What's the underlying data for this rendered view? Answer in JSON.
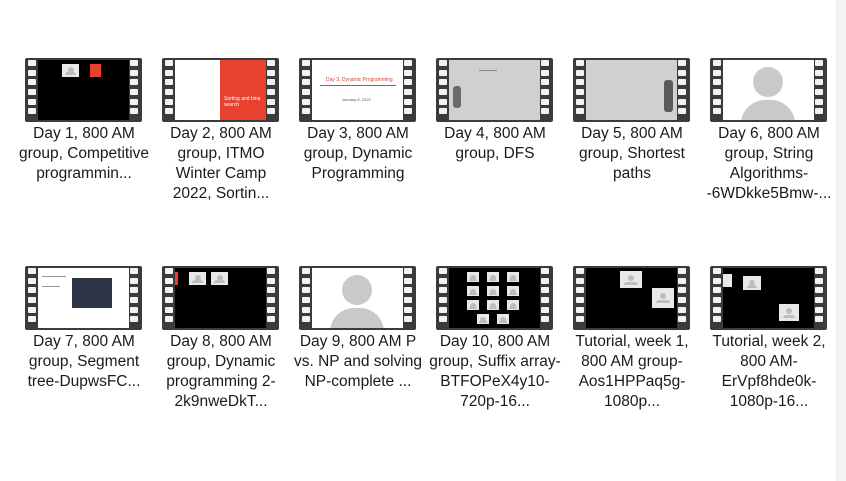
{
  "videos": [
    {
      "label": "Day 1, 800 AM group, Competitive programmin...",
      "thumbnail": "black-screen-with-participant-tiles"
    },
    {
      "label": "Day 2, 800 AM group, ITMO Winter Camp 2022, Sortin...",
      "thumbnail": "slide-sorting",
      "slide_text": "Sorting and bina search"
    },
    {
      "label": "Day 3, 800 AM group, Dynamic Programming",
      "thumbnail": "slide-title",
      "slide_text": "Day 3, Dynamic Programming",
      "slide_date": "January 6, 2022"
    },
    {
      "label": "Day 4, 800 AM group, DFS",
      "thumbnail": "whiteboard"
    },
    {
      "label": "Day 5, 800 AM group, Shortest paths",
      "thumbnail": "whiteboard"
    },
    {
      "label": "Day 6, 800 AM group, String Algorithms--6WDkke5Bmw-...",
      "thumbnail": "avatar"
    },
    {
      "label": "Day 7, 800 AM group, Segment tree-DupwsFC...",
      "thumbnail": "screen-share-code"
    },
    {
      "label": "Day 8, 800 AM group, Dynamic programming 2-2k9nweDkT...",
      "thumbnail": "black-screen-with-participant-tiles"
    },
    {
      "label": "Day 9, 800 AM P vs. NP and solving NP-complete ...",
      "thumbnail": "avatar"
    },
    {
      "label": "Day 10, 800 AM group, Suffix array-BTFOPeX4y10-720p-16...",
      "thumbnail": "participant-grid"
    },
    {
      "label": "Tutorial, week 1, 800 AM group-Aos1HPPaq5g-1080p...",
      "thumbnail": "black-screen-with-participant-tiles"
    },
    {
      "label": "Tutorial, week 2, 800 AM-ErVpf8hde0k-1080p-16...",
      "thumbnail": "black-screen-with-participant-tiles"
    }
  ]
}
